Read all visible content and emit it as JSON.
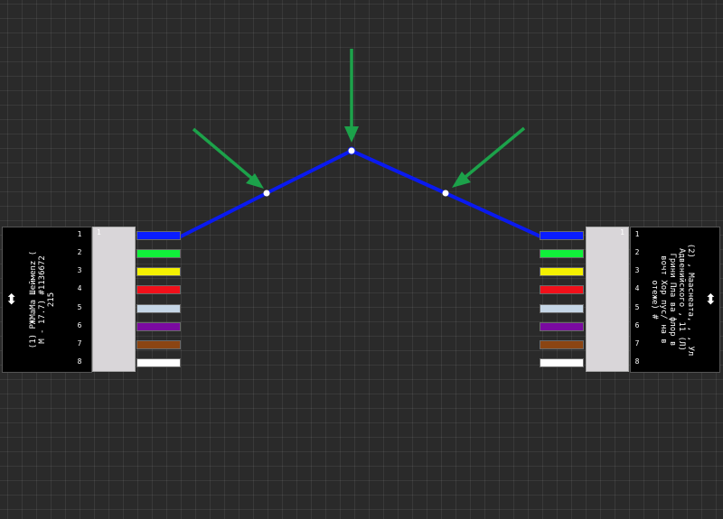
{
  "connectors": {
    "left": {
      "label": "(1) РЖМаМа Шеймеnz ( М - 17.7) #1136672 215",
      "pins": [
        "1",
        "2",
        "3",
        "4",
        "5",
        "6",
        "7",
        "8"
      ],
      "mark": "1"
    },
    "right": {
      "label": "(2) , Мааснеата, , , Ул Адвенийского , 11 (Л) Грини Пла ва флор в вочт Хор пус/ на в отеже) #",
      "pins": [
        "1",
        "2",
        "3",
        "4",
        "5",
        "6",
        "7",
        "8"
      ],
      "mark": "1"
    }
  },
  "wire_colors": [
    "#0a1dff",
    "#10f03a",
    "#f3f000",
    "#f0101a",
    "#c5d6e6",
    "#7a0aa0",
    "#8b4513",
    "#ffffff"
  ],
  "cable_color": "#0a1af0",
  "pointer_arrow_color": "#1ca24a",
  "panel_arrow_icon": "double-headed-vertical-arrow-icon"
}
